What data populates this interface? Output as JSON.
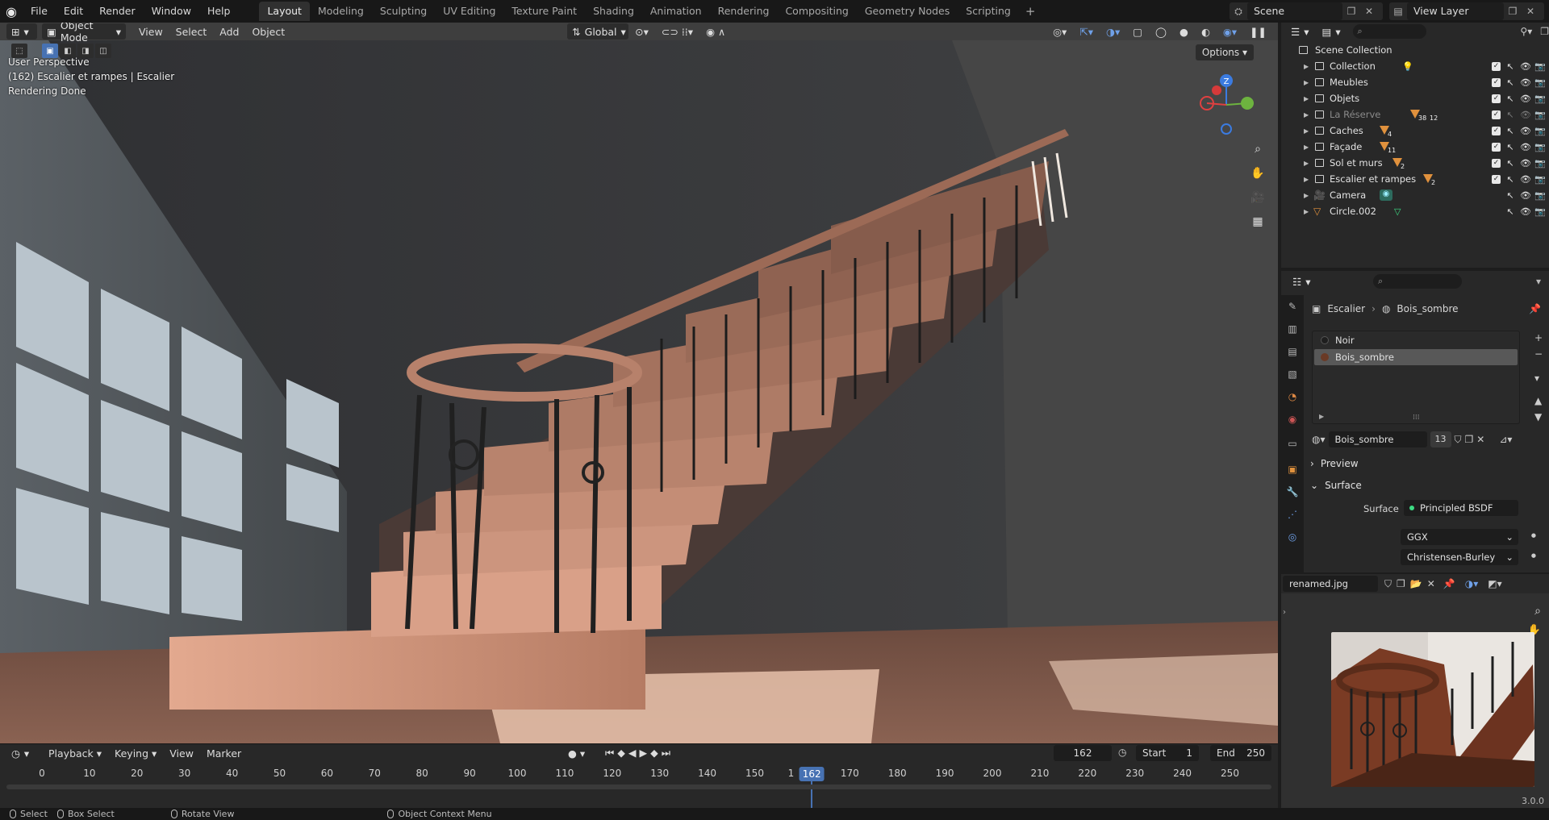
{
  "topbar": {
    "menu": [
      "File",
      "Edit",
      "Render",
      "Window",
      "Help"
    ],
    "workspaces": [
      "Layout",
      "Modeling",
      "Sculpting",
      "UV Editing",
      "Texture Paint",
      "Shading",
      "Animation",
      "Rendering",
      "Compositing",
      "Geometry Nodes",
      "Scripting"
    ],
    "active_workspace": "Layout",
    "scene": "Scene",
    "view_layer": "View Layer"
  },
  "viewport": {
    "mode": "Object Mode",
    "menus": [
      "View",
      "Select",
      "Add",
      "Object"
    ],
    "transform_orientation": "Global",
    "options_label": "Options",
    "overlay": {
      "perspective": "User Perspective",
      "object_info": "(162) Escalier et rampes | Escalier",
      "render_status": "Rendering Done"
    },
    "gizmo_axes": [
      "Z",
      "Y",
      "X"
    ]
  },
  "timeline": {
    "menus": [
      "Playback",
      "Keying",
      "View",
      "Marker"
    ],
    "current_frame": "162",
    "start_label": "Start",
    "start": "1",
    "end_label": "End",
    "end": "250",
    "ticks": [
      "0",
      "10",
      "20",
      "30",
      "40",
      "50",
      "60",
      "70",
      "80",
      "90",
      "100",
      "110",
      "120",
      "130",
      "140",
      "150",
      "1",
      "170",
      "180",
      "190",
      "200",
      "210",
      "220",
      "230",
      "240",
      "250"
    ],
    "cursor_label": "162"
  },
  "statusbar": {
    "select": "Select",
    "box_select": "Box Select",
    "rotate_view": "Rotate View",
    "context_menu": "Object Context Menu",
    "version": "3.0.0"
  },
  "outliner": {
    "root": "Scene Collection",
    "items": [
      {
        "label": "Collection",
        "count": ""
      },
      {
        "label": "Meubles",
        "count": ""
      },
      {
        "label": "Objets",
        "count": ""
      },
      {
        "label": "La Réserve",
        "count": "38"
      },
      {
        "label": "Caches",
        "count": "4"
      },
      {
        "label": "Façade",
        "count": "11"
      },
      {
        "label": "Sol et murs",
        "count": "2"
      },
      {
        "label": "Escalier et rampes",
        "count": "2"
      },
      {
        "label": "Camera",
        "count": ""
      },
      {
        "label": "Circle.002",
        "count": ""
      }
    ],
    "reserve_count2": "12"
  },
  "properties": {
    "breadcrumb_object": "Escalier",
    "breadcrumb_material": "Bois_sombre",
    "materials": [
      "Noir",
      "Bois_sombre"
    ],
    "selected_material": "Bois_sombre",
    "material_name": "Bois_sombre",
    "users": "13",
    "preview_label": "Preview",
    "surface_section": "Surface",
    "surface_label": "Surface",
    "surface_value": "Principled BSDF",
    "distribution": "GGX",
    "subsurface_method": "Christensen-Burley"
  },
  "image_editor": {
    "image_name": "renamed.jpg"
  },
  "colors": {
    "accent": "#4772b3",
    "collection_orange": "#e0913d",
    "mesh_green": "#3ddc84"
  }
}
